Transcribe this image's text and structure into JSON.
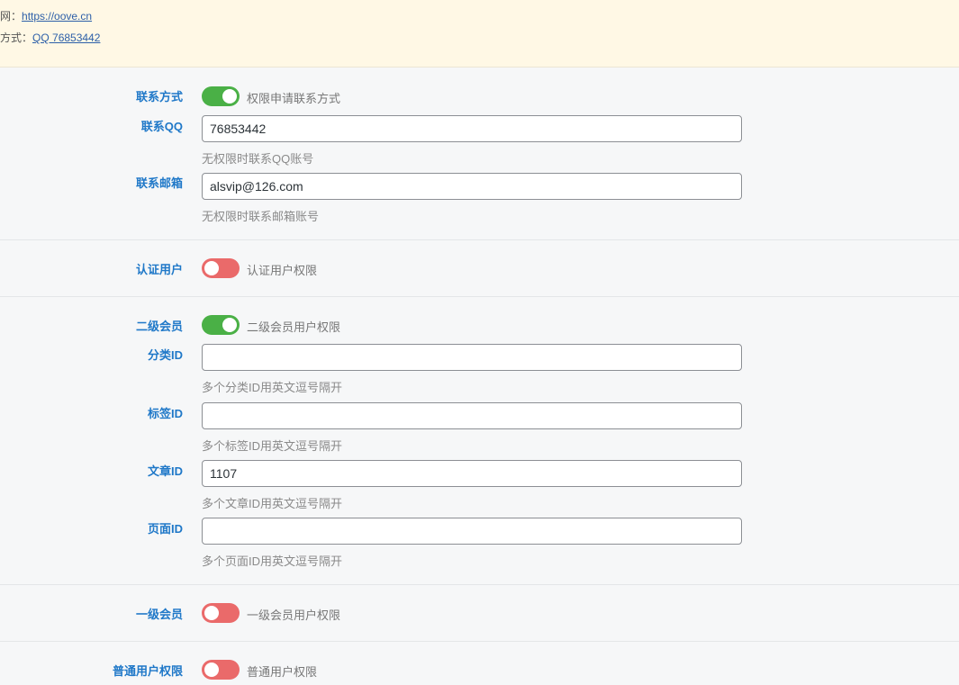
{
  "notice": {
    "site_prefix": "网：",
    "site_link": "https://oove.cn",
    "contact_prefix": "方式：",
    "contact_link": "QQ 76853442"
  },
  "contact_section": {
    "toggle": {
      "label": "联系方式",
      "description": "权限申请联系方式",
      "enabled": true
    },
    "qq": {
      "label": "联系QQ",
      "value": "76853442",
      "hint": "无权限时联系QQ账号"
    },
    "email": {
      "label": "联系邮箱",
      "value": "alsvip@126.com",
      "hint": "无权限时联系邮箱账号"
    }
  },
  "certified_user": {
    "label": "认证用户",
    "description": "认证用户权限",
    "enabled": false
  },
  "level2_member": {
    "toggle": {
      "label": "二级会员",
      "description": "二级会员用户权限",
      "enabled": true
    },
    "category_id": {
      "label": "分类ID",
      "value": "",
      "hint": "多个分类ID用英文逗号隔开"
    },
    "tag_id": {
      "label": "标签ID",
      "value": "",
      "hint": "多个标签ID用英文逗号隔开"
    },
    "post_id": {
      "label": "文章ID",
      "value": "1107",
      "hint": "多个文章ID用英文逗号隔开"
    },
    "page_id": {
      "label": "页面ID",
      "value": "",
      "hint": "多个页面ID用英文逗号隔开"
    }
  },
  "level1_member": {
    "label": "一级会员",
    "description": "一级会员用户权限",
    "enabled": false
  },
  "normal_user": {
    "label": "普通用户权限",
    "description": "普通用户权限",
    "enabled": false
  },
  "colors": {
    "toggle_on": "#4ab046",
    "toggle_off": "#ea6a6a",
    "label": "#1f78c8",
    "notice_bg": "#fff8e5"
  }
}
